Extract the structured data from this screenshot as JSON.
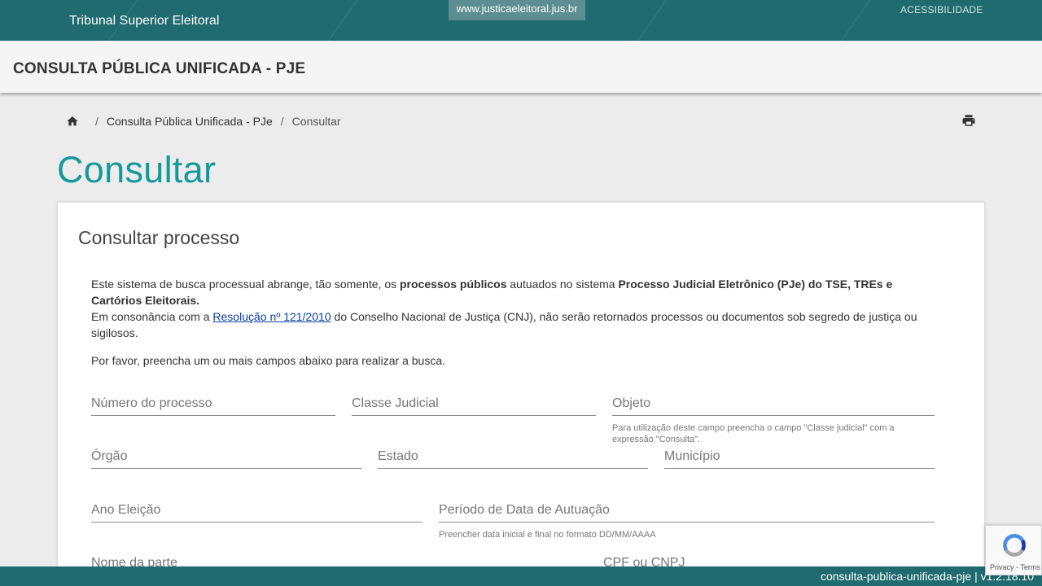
{
  "topbar": {
    "org_name": "Tribunal Superior Eleitoral",
    "site_link": "www.justicaeleitoral.jus.br",
    "accessibility": "ACESSIBILIDADE"
  },
  "header": {
    "title": "CONSULTA PÚBLICA UNIFICADA - PJE"
  },
  "breadcrumb": {
    "items": [
      "Consulta Pública Unificada - PJe",
      "Consultar"
    ],
    "home_icon": "home-icon",
    "print_icon": "print-icon"
  },
  "page": {
    "title": "Consultar"
  },
  "form": {
    "heading": "Consultar processo",
    "intro_1a": "Este sistema de busca processual abrange, tão somente, os ",
    "intro_1b": "processos públicos",
    "intro_1c": " autuados no sistema ",
    "intro_1d": "Processo Judicial Eletrônico (PJe) do TSE, TREs e Cartórios Eleitorais.",
    "intro_2a": "Em consonância com a ",
    "intro_2_link": "Resolução nº 121/2010",
    "intro_2b": " do Conselho Nacional de Justiça (CNJ), não serão retornados processos ou documentos sob segredo de justiça ou sigilosos.",
    "intro_3": "Por favor, preencha um ou mais campos abaixo para realizar a busca.",
    "fields": {
      "numero": "Número do processo",
      "classe": "Classe Judicial",
      "objeto": "Objeto",
      "objeto_hint": "Para utilização deste campo preencha o campo \"Classe judicial\" com a expressão \"Consulta\".",
      "orgao": "Órgão",
      "estado": "Estado",
      "municipio": "Município",
      "ano": "Ano Eleição",
      "periodo": "Período de Data de Autuação",
      "periodo_hint": "Preencher data inicial e final no formato DD/MM/AAAA",
      "parte": "Nome da parte",
      "cpf": "CPF ou CNPJ"
    }
  },
  "footer": {
    "version": "consulta-publica-unificada-pje | v1.2.18.10"
  },
  "recaptcha": {
    "terms": "Privacy - Terms"
  },
  "colors": {
    "brand": "#1f6b70",
    "title_accent": "#14999a",
    "link": "#0b3ea3"
  }
}
